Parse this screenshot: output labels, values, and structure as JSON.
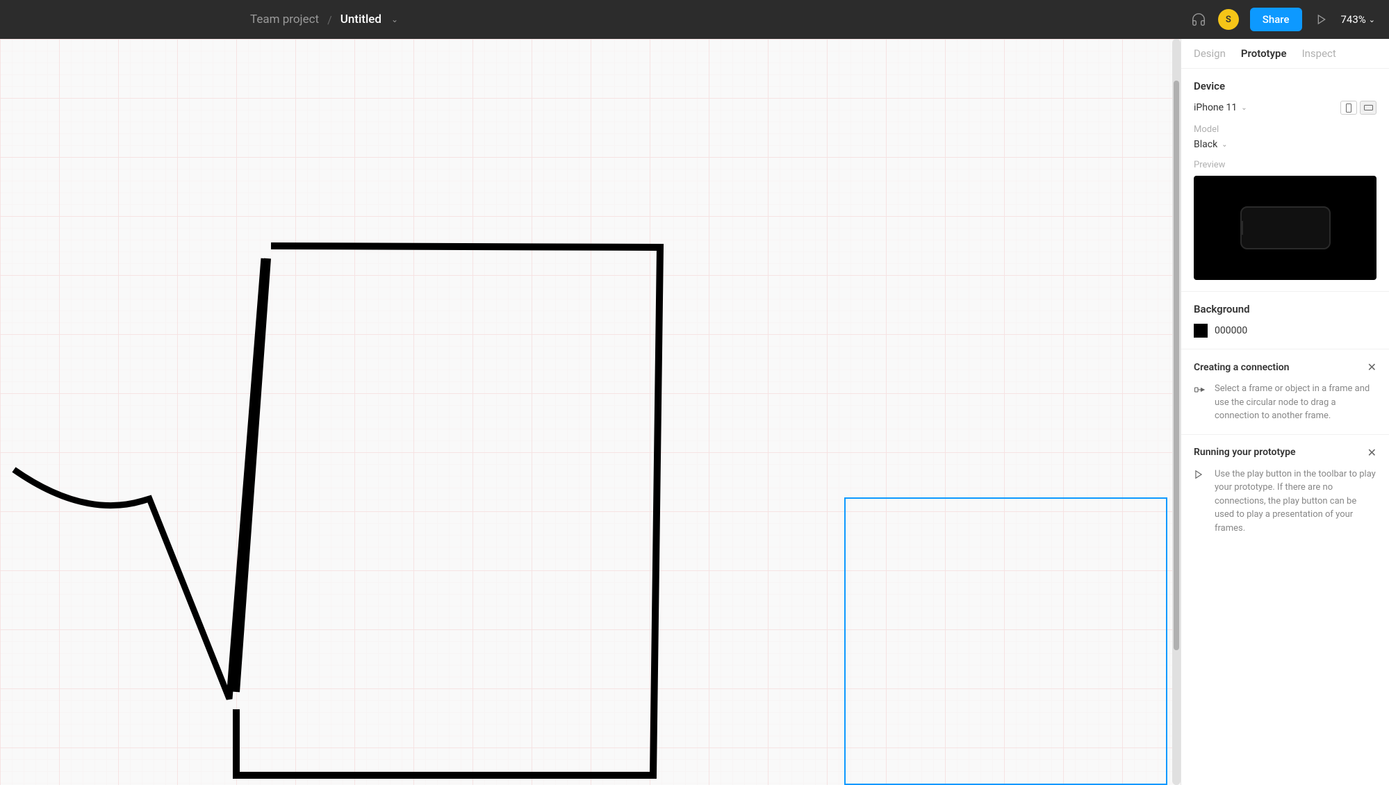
{
  "header": {
    "breadcrumb": "Team project",
    "filename": "Untitled",
    "avatar_initial": "S",
    "share_label": "Share",
    "zoom": "743%"
  },
  "sidebar": {
    "tabs": {
      "design": "Design",
      "prototype": "Prototype",
      "inspect": "Inspect"
    },
    "device": {
      "title": "Device",
      "value": "iPhone 11",
      "model_label": "Model",
      "model_value": "Black",
      "preview_label": "Preview"
    },
    "background": {
      "title": "Background",
      "value": "000000"
    },
    "info1": {
      "title": "Creating a connection",
      "text": "Select a frame or object in a frame and use the circular node to drag a connection to another frame."
    },
    "info2": {
      "title": "Running your prototype",
      "text": "Use the play button in the toolbar to play your prototype. If there are no connections, the play button can be used to play a presentation of your frames."
    }
  }
}
